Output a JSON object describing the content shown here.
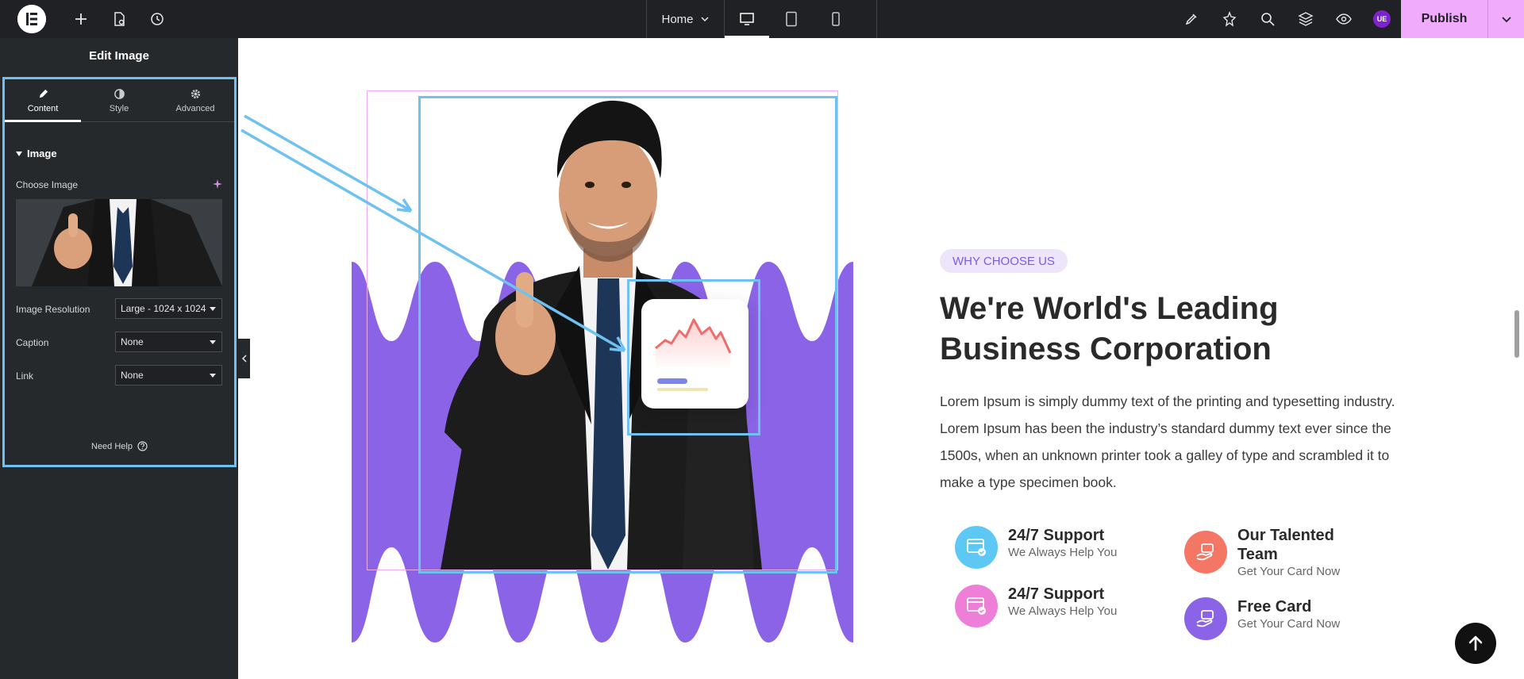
{
  "topbar": {
    "page_select": "Home",
    "publish_label": "Publish",
    "avatar_initials": "UE",
    "colors": {
      "bar": "#1f2124",
      "publish": "#f0abfc"
    }
  },
  "panel": {
    "title": "Edit Image",
    "tabs": [
      {
        "label": "Content",
        "icon": "pencil-icon"
      },
      {
        "label": "Style",
        "icon": "contrast-icon"
      },
      {
        "label": "Advanced",
        "icon": "gear-icon"
      }
    ],
    "section_title": "Image",
    "choose_image_label": "Choose Image",
    "fields": {
      "resolution": {
        "label": "Image Resolution",
        "value": "Large - 1024 x 1024"
      },
      "caption": {
        "label": "Caption",
        "value": "None"
      },
      "link": {
        "label": "Link",
        "value": "None"
      }
    },
    "help_label": "Need Help"
  },
  "content": {
    "badge": "WHY CHOOSE US",
    "headline_line1": "We're World's Leading",
    "headline_line2": "Business Corporation",
    "paragraph": "Lorem Ipsum is simply dummy text of the printing and typesetting industry. Lorem Ipsum has been the industry’s standard dummy text ever since the 1500s, when an unknown printer took a galley of type and scrambled it to make a type specimen book.",
    "features": [
      {
        "title": "24/7 Support",
        "subtitle": "We Always Help You",
        "color": "#5ec8f5"
      },
      {
        "title": "Our Talented Team",
        "subtitle": "Get Your Card Now",
        "color": "#f47766"
      },
      {
        "title": "24/7 Support",
        "subtitle": "We Always Help You",
        "color": "#ee7fd9"
      },
      {
        "title": "Free Card",
        "subtitle": "Get Your Card Now",
        "color": "#8a63e6"
      }
    ],
    "accent_color": "#8a63e6",
    "selection_color": "#6ec1f0"
  }
}
